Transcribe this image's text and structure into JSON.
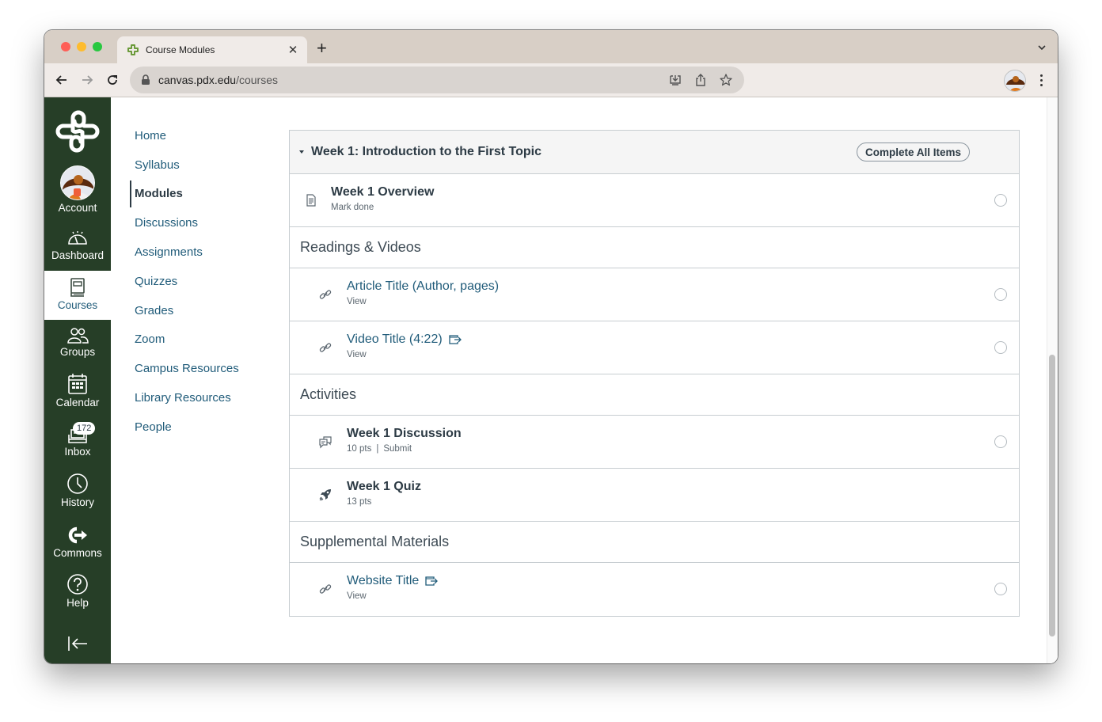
{
  "browser": {
    "tab_title": "Course Modules",
    "url_host": "canvas.pdx.edu",
    "url_path": "/courses"
  },
  "global_nav": {
    "items": [
      {
        "label": "Account",
        "icon": "avatar"
      },
      {
        "label": "Dashboard",
        "icon": "dashboard-icon"
      },
      {
        "label": "Courses",
        "icon": "courses-icon",
        "active": true
      },
      {
        "label": "Groups",
        "icon": "groups-icon"
      },
      {
        "label": "Calendar",
        "icon": "calendar-icon"
      },
      {
        "label": "Inbox",
        "icon": "inbox-icon",
        "badge": "172"
      },
      {
        "label": "History",
        "icon": "history-icon"
      },
      {
        "label": "Commons",
        "icon": "commons-icon"
      },
      {
        "label": "Help",
        "icon": "help-icon"
      }
    ]
  },
  "course_nav": {
    "items": [
      {
        "label": "Home"
      },
      {
        "label": "Syllabus"
      },
      {
        "label": "Modules",
        "active": true
      },
      {
        "label": "Discussions"
      },
      {
        "label": "Assignments"
      },
      {
        "label": "Quizzes"
      },
      {
        "label": "Grades"
      },
      {
        "label": "Zoom"
      },
      {
        "label": "Campus Resources"
      },
      {
        "label": "Library Resources"
      },
      {
        "label": "People"
      }
    ]
  },
  "module": {
    "title": "Week 1: Introduction to the First Topic",
    "complete_all_label": "Complete All Items",
    "overview": {
      "title": "Week 1 Overview",
      "sub": "Mark done",
      "icon": "page-icon"
    },
    "sections": [
      {
        "header": "Readings & Videos",
        "items": [
          {
            "title": "Article Title (Author, pages)",
            "sub": "View",
            "icon": "link-icon",
            "external": false,
            "checkbox": true
          },
          {
            "title": "Video Title (4:22)",
            "sub": "View",
            "icon": "link-icon",
            "external": true,
            "checkbox": true
          }
        ]
      },
      {
        "header": "Activities",
        "items": [
          {
            "title": "Week 1 Discussion",
            "pts": "10 pts",
            "action": "Submit",
            "icon": "discussion-icon",
            "checkbox": true
          },
          {
            "title": "Week 1 Quiz",
            "pts": "13 pts",
            "icon": "quiz-icon",
            "checkbox": false
          }
        ]
      },
      {
        "header": "Supplemental Materials",
        "items": [
          {
            "title": "Website Title",
            "sub": "View",
            "icon": "link-icon",
            "external": true,
            "checkbox": true
          }
        ]
      }
    ]
  },
  "colors": {
    "global_nav_bg": "#263e27",
    "link": "#215c7a",
    "text": "#2d3b45"
  }
}
